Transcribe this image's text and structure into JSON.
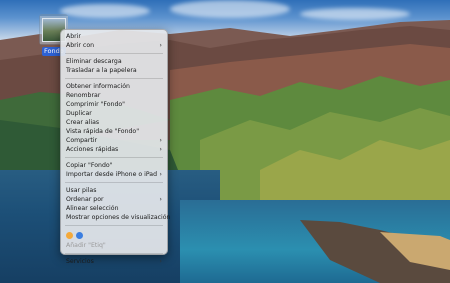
{
  "desktop": {
    "icon_label": "Fondo"
  },
  "menu": {
    "section1": [
      {
        "label": "Abrir",
        "submenu": false
      },
      {
        "label": "Abrir con",
        "submenu": true
      }
    ],
    "section2": [
      {
        "label": "Eliminar descarga",
        "submenu": false
      },
      {
        "label": "Trasladar a la papelera",
        "submenu": false
      }
    ],
    "section3": [
      {
        "label": "Obtener información",
        "submenu": false
      },
      {
        "label": "Renombrar",
        "submenu": false
      },
      {
        "label": "Comprimir \"Fondo\"",
        "submenu": false
      },
      {
        "label": "Duplicar",
        "submenu": false
      },
      {
        "label": "Crear alias",
        "submenu": false
      },
      {
        "label": "Vista rápida de \"Fondo\"",
        "submenu": false
      },
      {
        "label": "Compartir",
        "submenu": true
      },
      {
        "label": "Acciones rápidas",
        "submenu": true
      }
    ],
    "section4": [
      {
        "label": "Copiar \"Fondo\"",
        "submenu": false
      },
      {
        "label": "Importar desde iPhone o iPad",
        "submenu": true
      }
    ],
    "section5": [
      {
        "label": "Usar pilas",
        "submenu": false
      },
      {
        "label": "Ordenar por",
        "submenu": true
      },
      {
        "label": "Alinear selección",
        "submenu": false
      },
      {
        "label": "Mostrar opciones de visualización",
        "submenu": false
      }
    ],
    "tags_label": "Añadir \"Etiq\"",
    "tag_colors": [
      "#f4a93a",
      "#3b7ee0"
    ],
    "services_label": "Servicios",
    "chevron": "›"
  }
}
